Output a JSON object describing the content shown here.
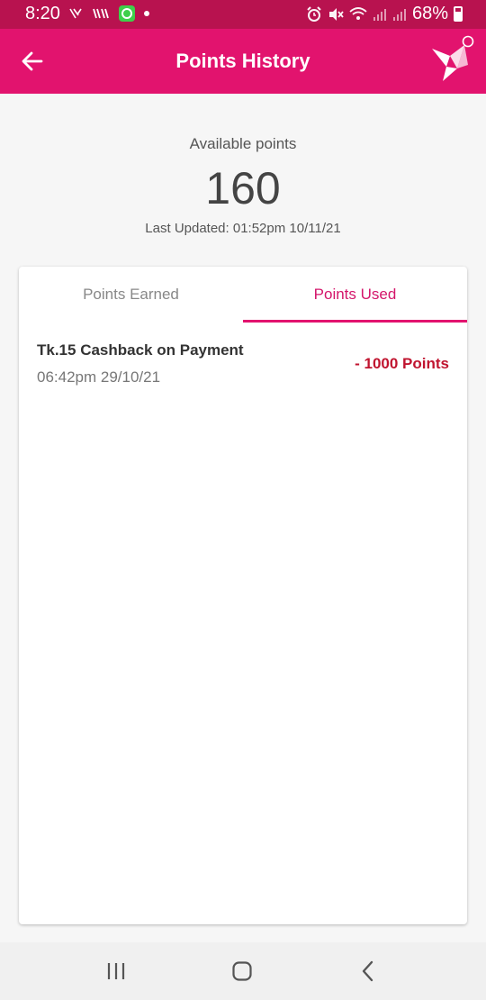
{
  "status_bar": {
    "time": "8:20",
    "battery": "68%",
    "color": "#b8124f"
  },
  "app_bar": {
    "title": "Points History",
    "color": "#e2136e",
    "back_icon": "arrow-left-icon",
    "logo_icon": "origami-bird-logo"
  },
  "summary": {
    "label": "Available points",
    "value": "160",
    "last_updated": "Last Updated: 01:52pm 10/11/21"
  },
  "tabs": [
    {
      "label": "Points Earned",
      "active": false
    },
    {
      "label": "Points Used",
      "active": true
    }
  ],
  "history": [
    {
      "title": "Tk.15 Cashback on Payment",
      "date": "06:42pm 29/10/21",
      "points": "- 1000 Points"
    }
  ],
  "colors": {
    "accent": "#e2136e",
    "negative": "#c0142f"
  },
  "nav_bar": {
    "icons": [
      "recent-apps-icon",
      "home-icon",
      "back-icon"
    ]
  }
}
